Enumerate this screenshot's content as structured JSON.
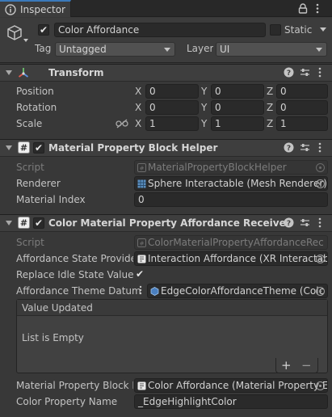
{
  "tab": {
    "label": "Inspector",
    "tools": "🔒 ⋮"
  },
  "header": {
    "object_name": "Color Affordance",
    "active": true,
    "static_label": "Static",
    "tag_label": "Tag",
    "tag_value": "Untagged",
    "layer_label": "Layer",
    "layer_value": "UI"
  },
  "transform": {
    "title": "Transform",
    "rows": [
      {
        "label": "Position",
        "x": "0",
        "y": "0",
        "z": "0"
      },
      {
        "label": "Rotation",
        "x": "0",
        "y": "0",
        "z": "0"
      },
      {
        "label": "Scale",
        "x": "1",
        "y": "1",
        "z": "1"
      }
    ],
    "axis_x": "X",
    "axis_y": "Y",
    "axis_z": "Z"
  },
  "mpb_helper": {
    "title": "Material Property Block Helper",
    "enabled": true,
    "script_label": "Script",
    "script_value": "MaterialPropertyBlockHelper",
    "renderer_label": "Renderer",
    "renderer_value": "Sphere Interactable (Mesh Renderer)",
    "material_index_label": "Material Index",
    "material_index_value": "0"
  },
  "receiver": {
    "title": "Color Material Property Affordance Receiver",
    "enabled": true,
    "script_label": "Script",
    "script_value": "ColorMaterialPropertyAffordanceRec",
    "provider_label": "Affordance State Provider",
    "provider_value": "Interaction Affordance (XR Interactab",
    "replace_label": "Replace Idle State Value V",
    "replace_checked": true,
    "theme_label": "Affordance Theme Datum",
    "theme_value": "EdgeColorAffordanceTheme (Colc",
    "event_title": "Value Updated",
    "event_empty": "List is Empty",
    "add_label": "+",
    "remove_label": "−",
    "mpb_label": "Material Property Block H",
    "mpb_value": "Color Affordance (Material Property E",
    "color_prop_label": "Color Property Name",
    "color_prop_value": "_EdgeHighlightColor"
  }
}
